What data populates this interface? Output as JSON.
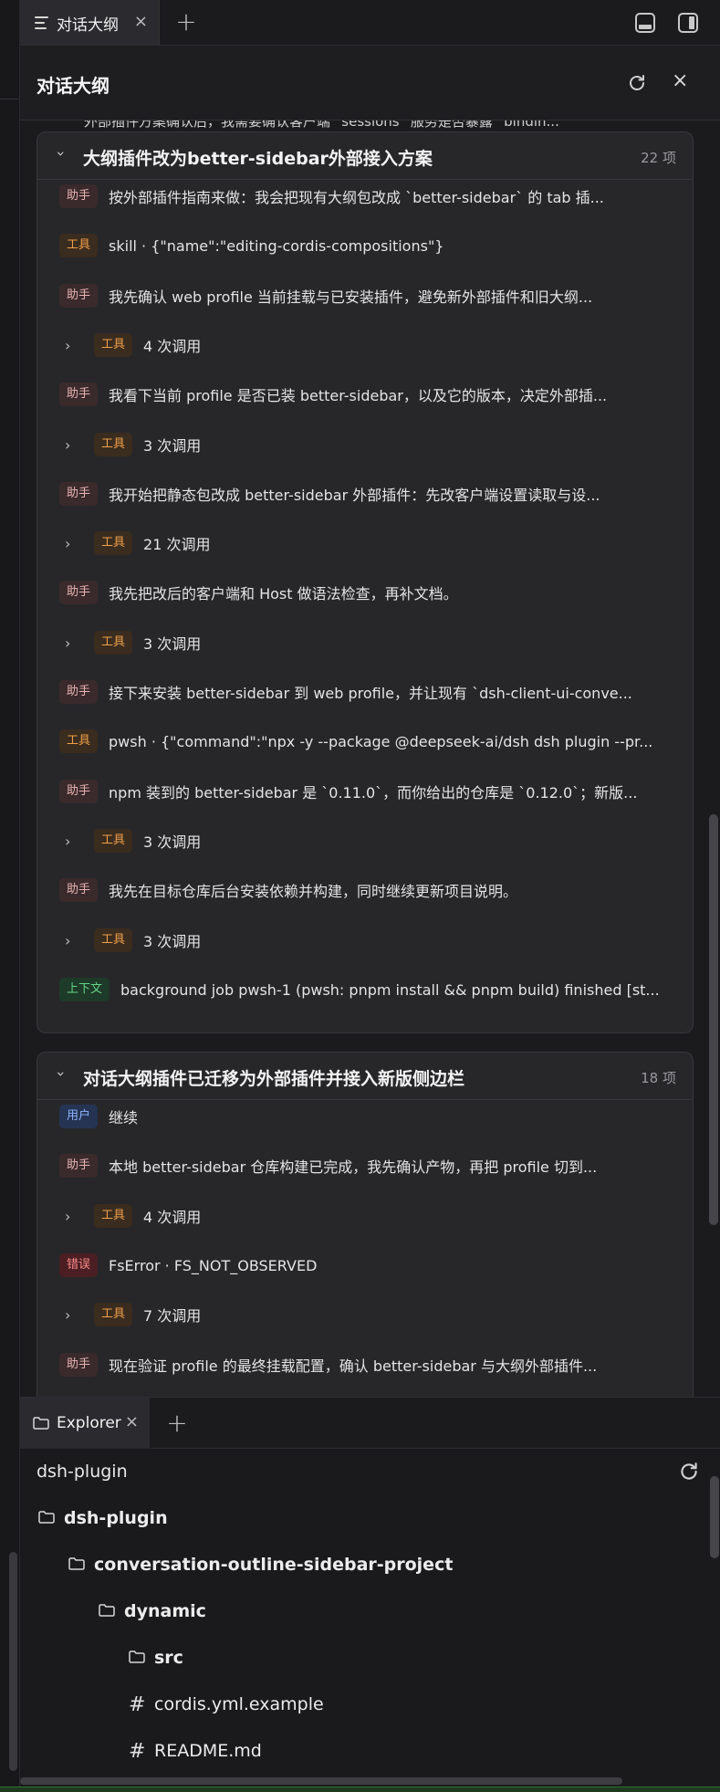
{
  "top_tabs": {
    "active_tab_label": "对话大纲",
    "close_glyph": "×",
    "add_glyph": "+"
  },
  "outline": {
    "title": "对话大纲",
    "close_glyph": "×",
    "partial_row_text": "外部插件方案确认后，我需要确认客户端 `sessions` 服务是否暴露 `bindin...",
    "groups": [
      {
        "title": "大纲插件改为better-sidebar外部接入方案",
        "count": "22 项",
        "rows": [
          {
            "kind": "msg",
            "badge": "助手",
            "text": "按外部插件指南来做：我会把现有大纲包改成 `better-sidebar` 的 tab 插..."
          },
          {
            "kind": "msg",
            "badge": "工具",
            "text": "skill · {\"name\":\"editing-cordis-compositions\"}"
          },
          {
            "kind": "msg",
            "badge": "助手",
            "text": "我先确认 web profile 当前挂载与已安装插件，避免新外部插件和旧大纲..."
          },
          {
            "kind": "calls",
            "badge": "工具",
            "text": "4 次调用"
          },
          {
            "kind": "msg",
            "badge": "助手",
            "text": "我看下当前 profile 是否已装 better-sidebar，以及它的版本，决定外部插..."
          },
          {
            "kind": "calls",
            "badge": "工具",
            "text": "3 次调用"
          },
          {
            "kind": "msg",
            "badge": "助手",
            "text": "我开始把静态包改成 better-sidebar 外部插件：先改客户端设置读取与设..."
          },
          {
            "kind": "calls",
            "badge": "工具",
            "text": "21 次调用"
          },
          {
            "kind": "msg",
            "badge": "助手",
            "text": "我先把改后的客户端和 Host 做语法检查，再补文档。"
          },
          {
            "kind": "calls",
            "badge": "工具",
            "text": "3 次调用"
          },
          {
            "kind": "msg",
            "badge": "助手",
            "text": "接下来安装 better-sidebar 到 web profile，并让现有 `dsh-client-ui-conve..."
          },
          {
            "kind": "msg",
            "badge": "工具",
            "text": "pwsh · {\"command\":\"npx -y --package @deepseek-ai/dsh dsh plugin --pr..."
          },
          {
            "kind": "msg",
            "badge": "助手",
            "text": "npm 装到的 better-sidebar 是 `0.11.0`，而你给出的仓库是 `0.12.0`；新版..."
          },
          {
            "kind": "calls",
            "badge": "工具",
            "text": "3 次调用"
          },
          {
            "kind": "msg",
            "badge": "助手",
            "text": "我先在目标仓库后台安装依赖并构建，同时继续更新项目说明。"
          },
          {
            "kind": "calls",
            "badge": "工具",
            "text": "3 次调用"
          },
          {
            "kind": "msg",
            "badge": "上下文",
            "text": "background job pwsh-1 (pwsh: pnpm install && pnpm build) finished [st..."
          }
        ]
      },
      {
        "title": "对话大纲插件已迁移为外部插件并接入新版侧边栏",
        "count": "18 项",
        "rows": [
          {
            "kind": "msg",
            "badge": "用户",
            "text": "继续"
          },
          {
            "kind": "msg",
            "badge": "助手",
            "text": "本地 better-sidebar 仓库构建已完成，我先确认产物，再把 profile 切到..."
          },
          {
            "kind": "calls",
            "badge": "工具",
            "text": "4 次调用"
          },
          {
            "kind": "msg",
            "badge": "错误",
            "text": "FsError · FS_NOT_OBSERVED"
          },
          {
            "kind": "calls",
            "badge": "工具",
            "text": "7 次调用"
          },
          {
            "kind": "msg",
            "badge": "助手",
            "text": "现在验证 profile 的最终挂载配置，确认 better-sidebar 与大纲外部插件..."
          }
        ]
      }
    ]
  },
  "explorer": {
    "tab_label": "Explorer",
    "close_glyph": "×",
    "add_glyph": "+",
    "root_title": "dsh-plugin",
    "tree": [
      {
        "name": "dsh-plugin",
        "type": "folder",
        "depth": 0
      },
      {
        "name": "conversation-outline-sidebar-project",
        "type": "folder",
        "depth": 1
      },
      {
        "name": "dynamic",
        "type": "folder",
        "depth": 2
      },
      {
        "name": "src",
        "type": "folder",
        "depth": 3
      },
      {
        "name": "cordis.yml.example",
        "type": "file",
        "depth": 3
      },
      {
        "name": "README.md",
        "type": "file",
        "depth": 3
      }
    ]
  },
  "badge_colors": {
    "助手": "#e9b4b4",
    "工具": "#f0a04b",
    "上下文": "#66d48a",
    "用户": "#8fb2ff",
    "错误": "#ff8a8a"
  },
  "icons": [
    "outline-list-icon",
    "close-icon",
    "plus-icon",
    "panel-bottom-icon",
    "panel-right-icon",
    "refresh-icon",
    "chevron-down-icon",
    "chevron-right-icon",
    "folder-icon",
    "hash-file-icon"
  ]
}
